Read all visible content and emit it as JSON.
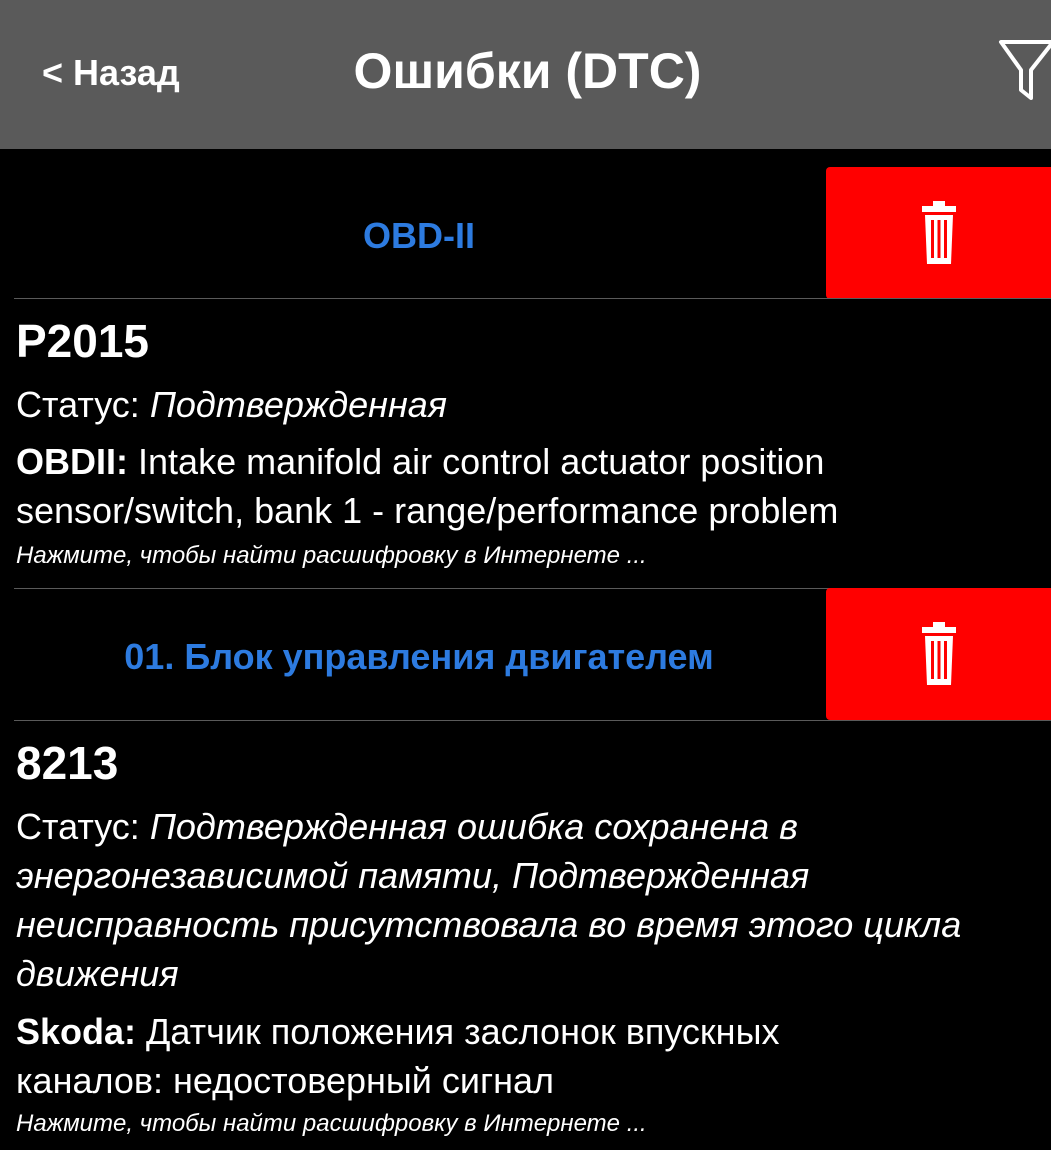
{
  "header": {
    "back_label": "< Назад",
    "title": "Ошибки (DTC)",
    "filter_icon": "filter-icon"
  },
  "sections": [
    {
      "title": "OBD-II",
      "delete_icon": "trash-icon",
      "error": {
        "code": "P2015",
        "status_label": "Статус:",
        "status_value": "Подтвержденная",
        "source_label": "OBDII:",
        "description_line1": "Intake manifold air control actuator position",
        "description_line2": "sensor/switch, bank 1 - range/performance problem",
        "hint": "Нажмите, чтобы найти расшифровку в Интернете ..."
      }
    },
    {
      "title": "01. Блок управления двигателем",
      "delete_icon": "trash-icon",
      "error": {
        "code": "8213",
        "status_label": "Статус:",
        "status_value_line1": "Подтвержденная ошибка сохранена в",
        "status_value_line2": "энергонезависимой памяти, Подтвержденная",
        "status_value_line3": "неисправность присутствовала во время этого цикла",
        "status_value_line4": "движения",
        "source_label": "Skoda:",
        "description_line1": "Датчик положения заслонок впускных",
        "description_line2": "каналов: недостоверный сигнал",
        "hint": "Нажмите, чтобы найти расшифровку в Интернете ..."
      }
    }
  ],
  "colors": {
    "header_bg": "#5a5a5a",
    "section_title": "#2d7be0",
    "delete_bg": "#ff0000"
  }
}
